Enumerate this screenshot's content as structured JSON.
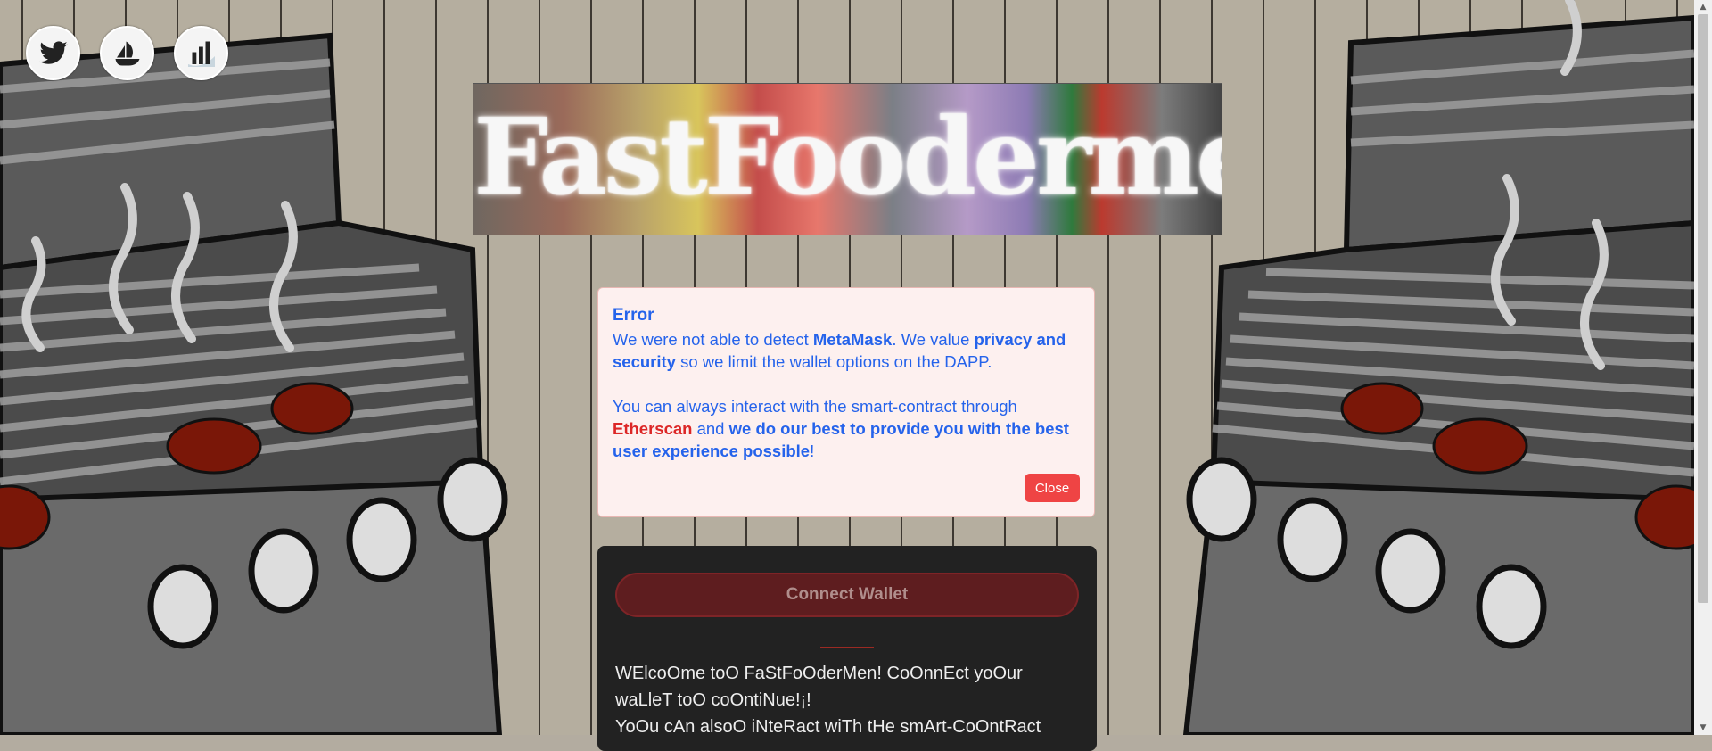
{
  "social": [
    {
      "name": "twitter-icon"
    },
    {
      "name": "opensea-icon"
    },
    {
      "name": "chart-icon"
    }
  ],
  "banner": {
    "title": "FastFoodermen"
  },
  "error_dialog": {
    "title": "Error",
    "p1_a": "We were not able to detect ",
    "p1_b": "MetaMask",
    "p1_c": ". We value ",
    "p1_d": "privacy and security",
    "p1_e": " so we limit the wallet options on the DAPP.",
    "p2_a": "You can always interact with the smart-contract through ",
    "p2_b": "Etherscan",
    "p2_c": " and ",
    "p2_d": "we do our best to provide you with the best user experience possible",
    "p2_e": "!",
    "close_label": "Close"
  },
  "panel": {
    "connect_label": "Connect Wallet",
    "welcome_1": "WElcoOme toO FaStFoOderMen! CoOnnEct yoOur waLleT toO coOntiNue!¡!",
    "welcome_2": "YoOu cAn alsoO iNteRact wiTh tHe smArt-CoOntRact"
  },
  "colors": {
    "dialog_text": "#2563eb",
    "etherscan": "#dc2626",
    "close_button": "#ef4444",
    "connect_button": "#5e1d1f"
  }
}
